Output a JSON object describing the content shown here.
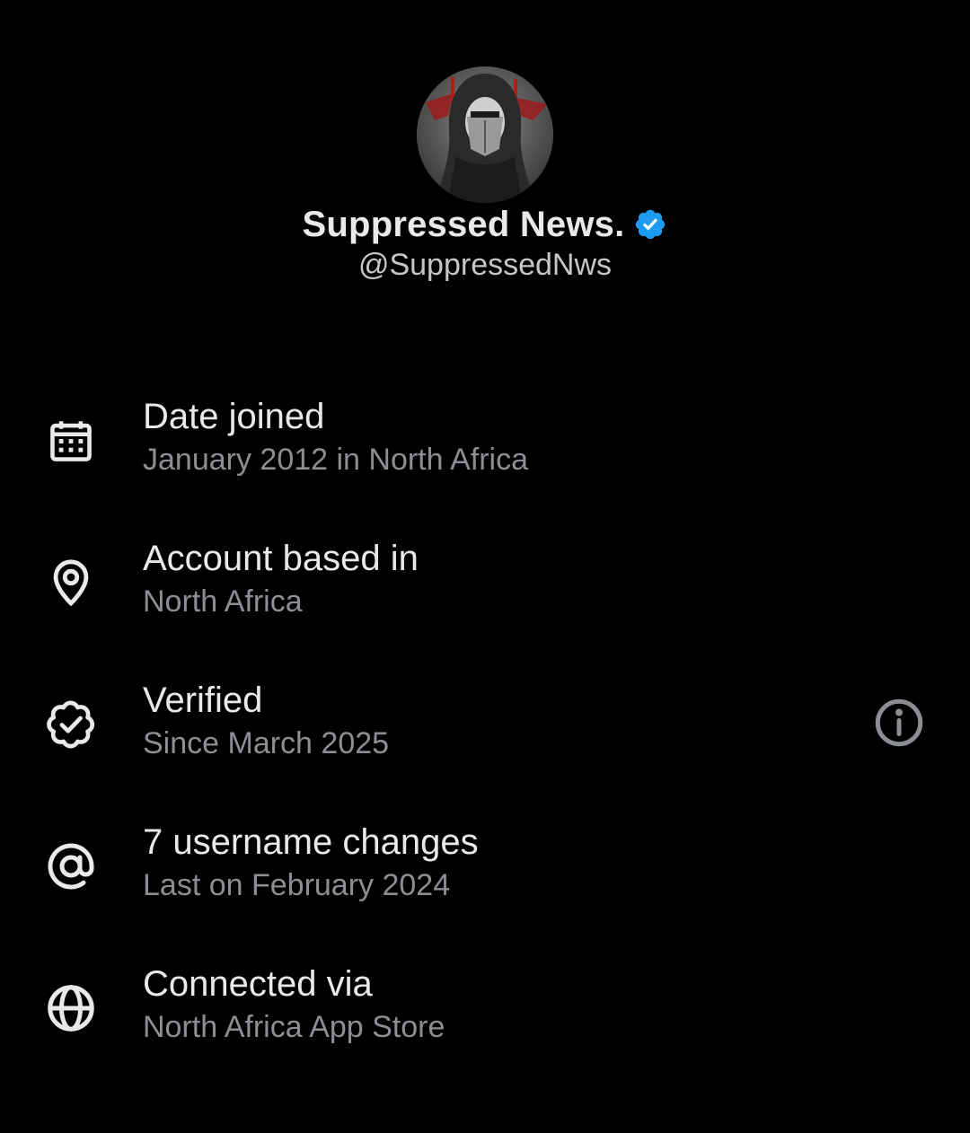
{
  "profile": {
    "display_name": "Suppressed News.",
    "handle": "@SuppressedNws",
    "verified_color": "#1d9bf0"
  },
  "info_items": [
    {
      "icon": "calendar-icon",
      "title": "Date joined",
      "subtitle": "January 2012 in North Africa"
    },
    {
      "icon": "location-pin-icon",
      "title": "Account based in",
      "subtitle": "North Africa"
    },
    {
      "icon": "verified-badge-icon",
      "title": "Verified",
      "subtitle": "Since March 2025"
    },
    {
      "icon": "at-sign-icon",
      "title": "7 username changes",
      "subtitle": "Last on February 2024"
    },
    {
      "icon": "globe-icon",
      "title": "Connected via",
      "subtitle": "North Africa App Store"
    }
  ],
  "colors": {
    "background": "#000000",
    "primary_text": "#e7e9ea",
    "secondary_text": "#8b8f93",
    "icon": "#e7e9ea",
    "info_icon": "#8b8f93"
  }
}
